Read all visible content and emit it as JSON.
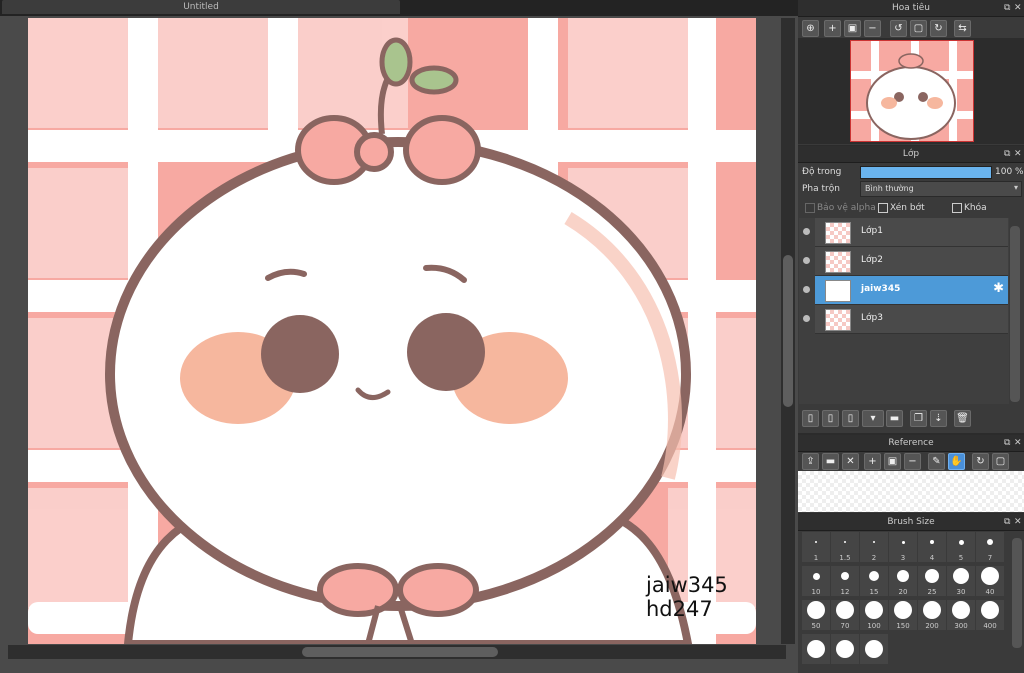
{
  "document": {
    "tab_title": "Untitled"
  },
  "artwork": {
    "watermark_line1": "jaiw345",
    "watermark_line2": "hd247"
  },
  "navigator": {
    "title": "Hoa tiêu"
  },
  "layers": {
    "title": "Lớp",
    "opacity_label": "Độ trong",
    "opacity_value": "100 %",
    "opacity_fraction": 1.0,
    "blend_label": "Pha trộn",
    "blend_value": "Bình thường",
    "protect_alpha": "Bảo vệ alpha",
    "clipping": "Xén bớt",
    "lock": "Khóa",
    "items": [
      {
        "name": "Lớp1",
        "selected": false
      },
      {
        "name": "Lớp2",
        "selected": false
      },
      {
        "name": "jaiw345",
        "selected": true
      },
      {
        "name": "Lớp3",
        "selected": false
      }
    ]
  },
  "reference": {
    "title": "Reference"
  },
  "brush_size": {
    "title": "Brush Size",
    "sizes": [
      "1",
      "1.5",
      "2",
      "3",
      "4",
      "5",
      "7",
      "10",
      "12",
      "15",
      "20",
      "25",
      "30",
      "40",
      "50",
      "70",
      "100",
      "150",
      "200",
      "300",
      "400"
    ]
  },
  "colors": {
    "accent": "#4d9ad8",
    "panel_bg": "#3a3a3a",
    "bg_pink": "#f6b7b0",
    "outline": "#8a6560",
    "blush": "#f6b79e"
  }
}
